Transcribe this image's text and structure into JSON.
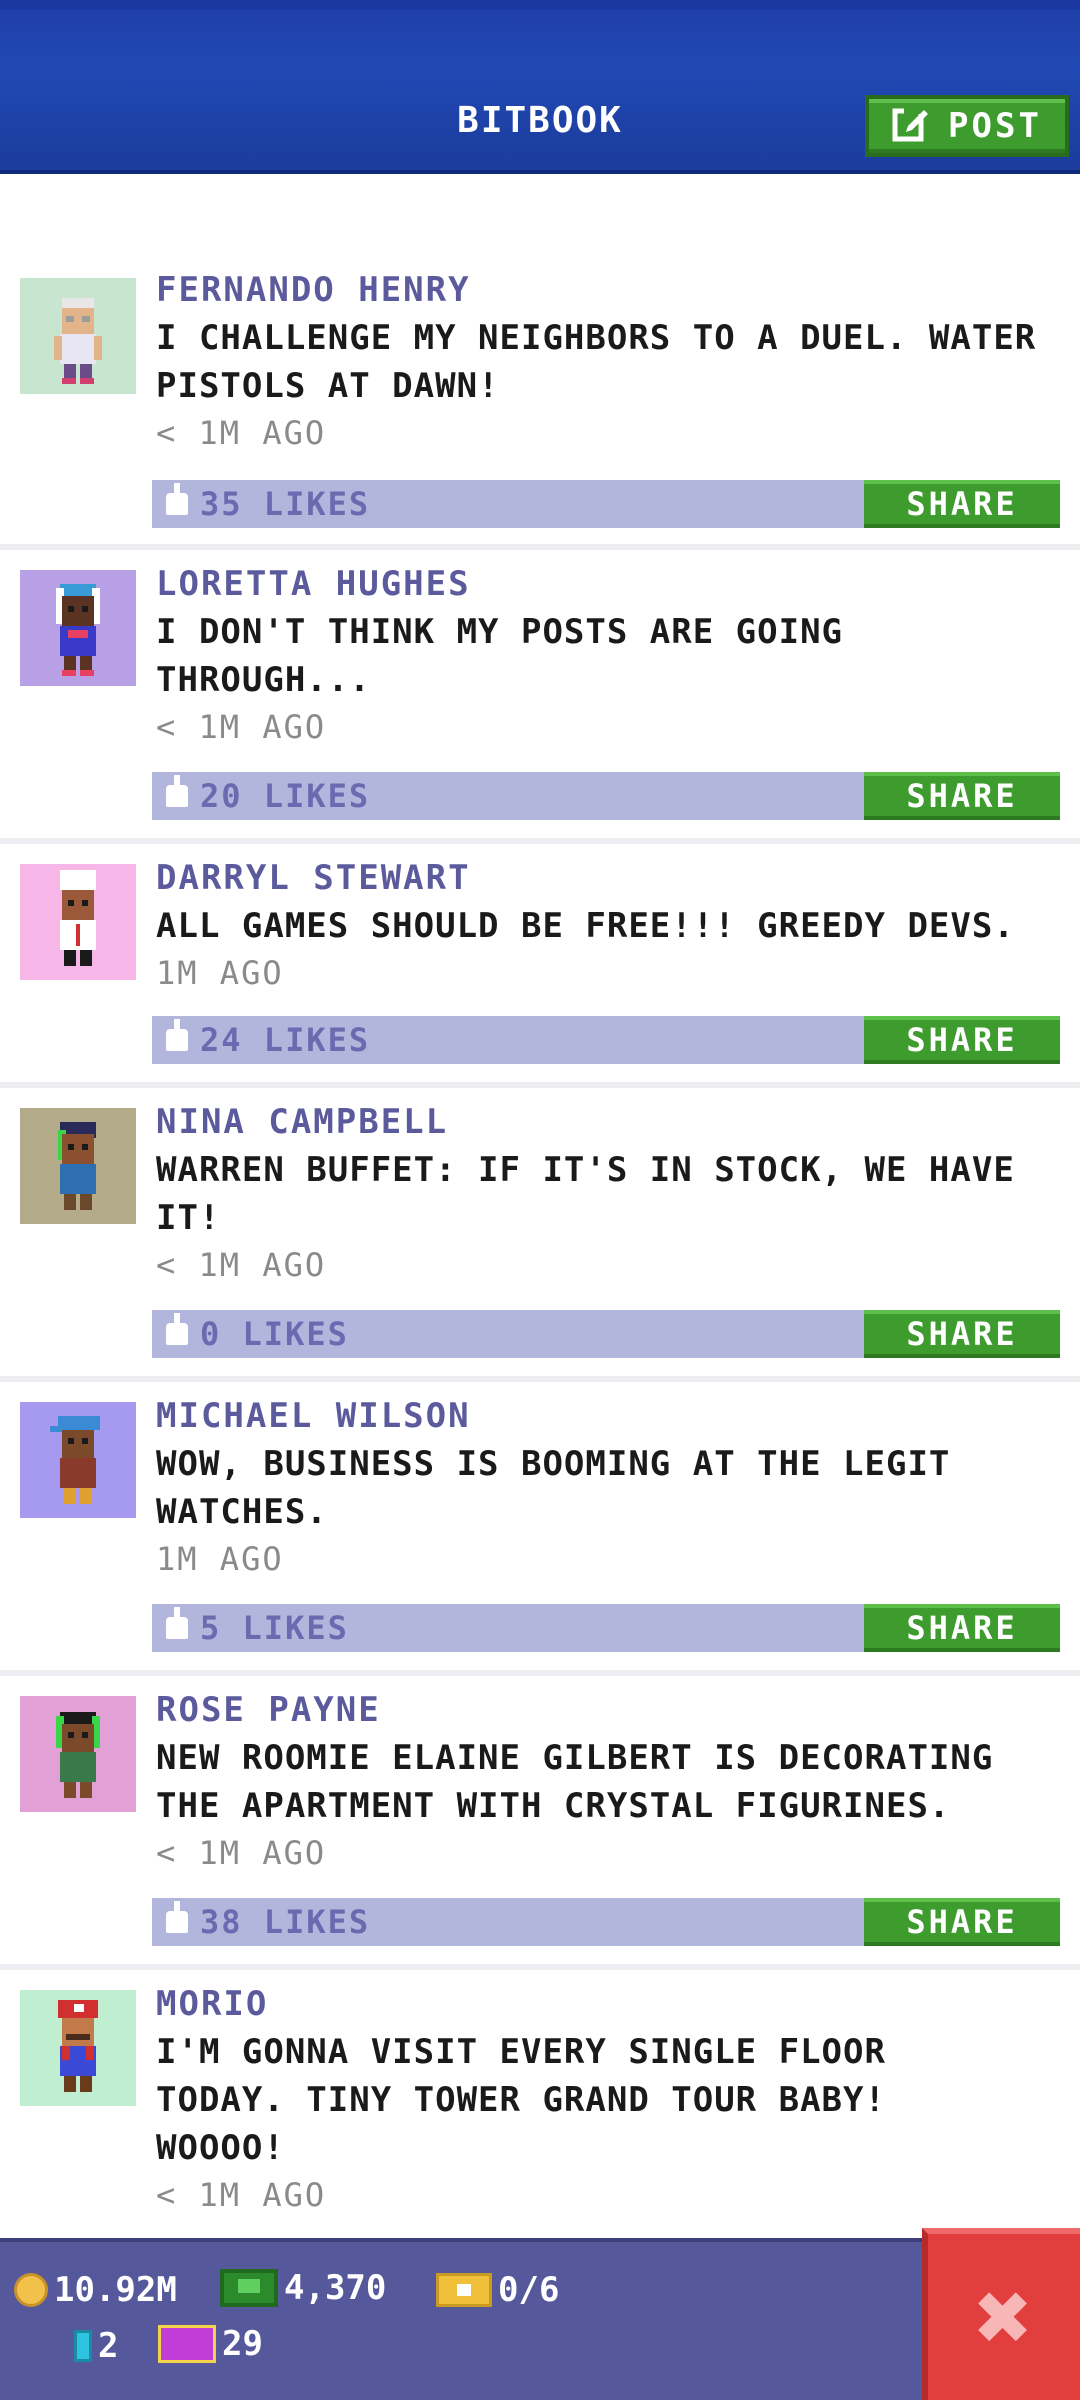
{
  "header": {
    "title": "BITBOOK",
    "post_label": "POST"
  },
  "posts": [
    {
      "name": "FERNANDO HENRY",
      "message": "I CHALLENGE MY NEIGHBORS TO A DUEL. WATER PISTOLS AT DAWN!",
      "time": "< 1M AGO",
      "likes": "35 LIKES",
      "share_label": "SHARE",
      "avatar_bg": "#c8e6cf"
    },
    {
      "name": "LORETTA HUGHES",
      "message": "I DON'T THINK MY POSTS ARE GOING THROUGH...",
      "time": "< 1M AGO",
      "likes": "20 LIKES",
      "share_label": "SHARE",
      "avatar_bg": "#b7a0e6"
    },
    {
      "name": "DARRYL STEWART",
      "message": "ALL GAMES SHOULD BE FREE!!! GREEDY DEVS.",
      "time": "1M AGO",
      "likes": "24 LIKES",
      "share_label": "SHARE",
      "avatar_bg": "#f7b6e8"
    },
    {
      "name": "NINA CAMPBELL",
      "message": "WARREN BUFFET: IF IT'S IN STOCK, WE HAVE IT!",
      "time": "< 1M AGO",
      "likes": "0 LIKES",
      "share_label": "SHARE",
      "avatar_bg": "#b3ab8a"
    },
    {
      "name": "MICHAEL WILSON",
      "message": "WOW, BUSINESS IS BOOMING AT THE LEGIT WATCHES.",
      "time": "1M AGO",
      "likes": "5 LIKES",
      "share_label": "SHARE",
      "avatar_bg": "#a59af0"
    },
    {
      "name": "ROSE PAYNE",
      "message": "NEW ROOMIE ELAINE GILBERT IS DECORATING THE APARTMENT WITH CRYSTAL FIGURINES.",
      "time": "< 1M AGO",
      "likes": "38 LIKES",
      "share_label": "SHARE",
      "avatar_bg": "#e3a0d6"
    },
    {
      "name": "MORIO",
      "message": "I'M GONNA VISIT EVERY SINGLE FLOOR TODAY. TINY TOWER GRAND TOUR BABY! WOOOO!",
      "time": "< 1M AGO",
      "likes": "",
      "share_label": "",
      "avatar_bg": "#bfeed0"
    }
  ],
  "resources": {
    "coins": "10.92M",
    "bux": "4,370",
    "tickets": "0/6",
    "batteries": "2",
    "vip": "29"
  },
  "icons": {
    "post": "edit-icon",
    "like": "thumbs-up-icon",
    "coin": "coin-icon",
    "bux": "bux-icon",
    "ticket": "ticket-icon",
    "battery": "battery-icon",
    "vip": "vip-card-icon",
    "close": "close-icon"
  }
}
